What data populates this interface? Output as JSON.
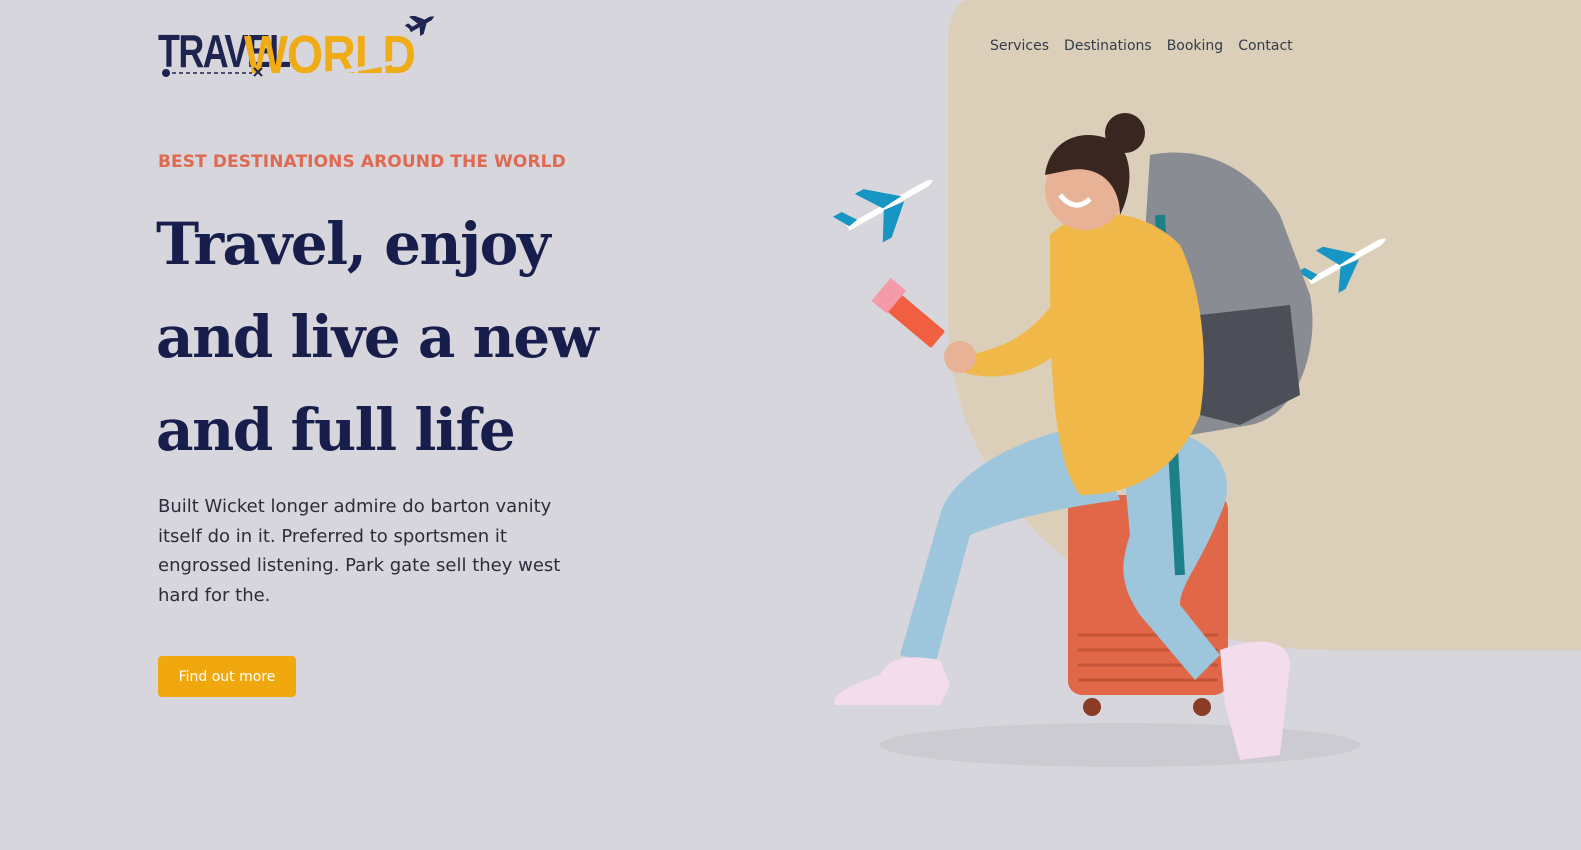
{
  "brand": {
    "logo_part1": "TRAVEL",
    "logo_part2": "WORLD",
    "colors": {
      "navy": "#1e2450",
      "yellow": "#f0ac17",
      "accent": "#df6951",
      "background": "#d6d6dc",
      "blob": "#dccfba"
    }
  },
  "nav": {
    "items": [
      {
        "label": "Services"
      },
      {
        "label": "Destinations"
      },
      {
        "label": "Booking"
      },
      {
        "label": "Contact"
      }
    ]
  },
  "hero": {
    "eyebrow": "BEST DESTINATIONS AROUND THE WORLD",
    "headline": "Travel, enjoy and live a new and full life",
    "description": "Built Wicket longer admire do barton vanity itself do in it. Preferred to sportsmen it engrossed listening. Park gate sell they west hard for the.",
    "cta_label": "Find out more"
  },
  "illustration": {
    "subject": "traveler-with-backpack-on-suitcase",
    "icons": [
      "airplane-icon",
      "airplane-icon",
      "logo-airplane-icon"
    ]
  }
}
